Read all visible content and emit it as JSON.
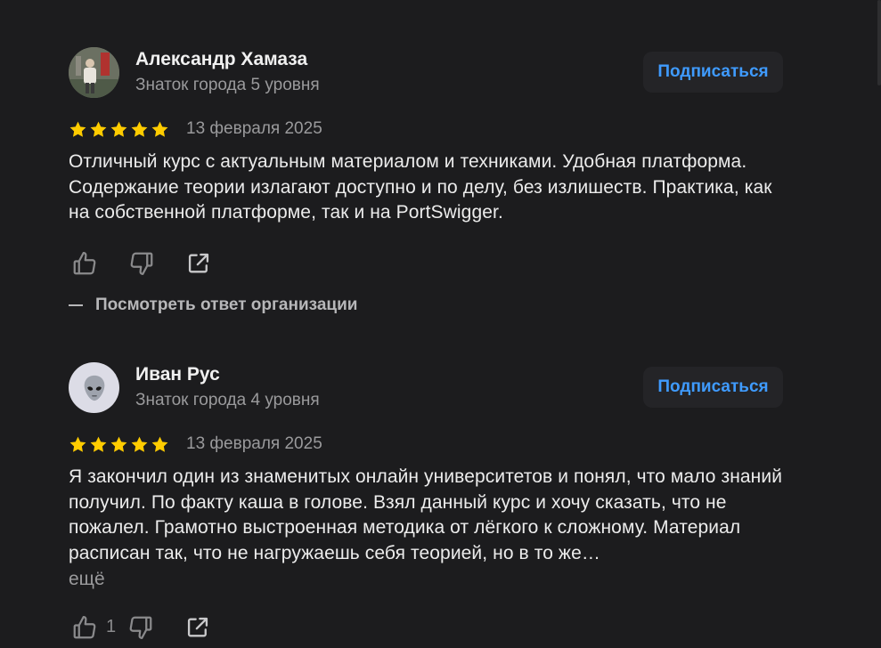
{
  "colors": {
    "background": "#1c1c1e",
    "accent": "#3f9bff",
    "star": "#ffcc00",
    "muted": "#9a9a9c"
  },
  "reviews": [
    {
      "author": "Александр Хамаза",
      "level": "Знаток города 5 уровня",
      "subscribe_label": "Подписаться",
      "rating": 5,
      "date": "13 февраля 2025",
      "text": "Отличный курс с актуальным материалом и техниками. Удобная платформа. Содержание теории излагают доступно и по делу, без излишеств. Практика, как на собственной платформе, так и на PortSwigger.",
      "org_answer_label": "Посмотреть ответ организации",
      "icons": [
        "thumbs-up-icon",
        "thumbs-down-icon",
        "share-icon"
      ]
    },
    {
      "author": "Иван Рус",
      "level": "Знаток города 4 уровня",
      "subscribe_label": "Подписаться",
      "rating": 5,
      "date": "13 февраля 2025",
      "text": "Я закончил один из знаменитых онлайн университетов и понял, что мало знаний получил. По факту каша в голове. Взял данный курс и хочу сказать, что не пожалел. Грамотно выстроенная методика от лёгкого к сложному. Материал расписан так, что не нагружаешь себя теорией, но в то же…",
      "more_label": "ещё",
      "likes": "1",
      "avatar_icon": "alien-icon",
      "icons": [
        "thumbs-up-icon",
        "thumbs-down-icon",
        "share-icon"
      ]
    }
  ]
}
